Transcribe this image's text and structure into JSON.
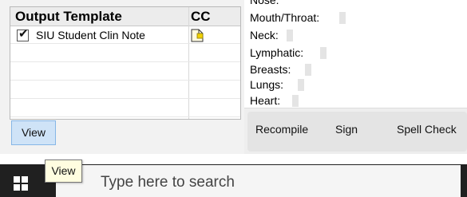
{
  "template_panel": {
    "col_output": "Output Template",
    "col_cc": "CC",
    "rows": [
      {
        "name": "SIU Student Clin Note",
        "checked": true,
        "cc_icon": "note-icon"
      }
    ],
    "view_label": "View"
  },
  "exam": {
    "partial_top": "Nose:",
    "fields": [
      "Mouth/Throat:",
      "Neck:",
      "Lymphatic:",
      "Breasts:",
      "Lungs:",
      "Heart:"
    ]
  },
  "toolbar": {
    "recompile": "Recompile",
    "sign": "Sign",
    "spell_check": "Spell Check"
  },
  "taskbar": {
    "tooltip": "View",
    "search_placeholder": "Type here to search",
    "start_icon": "windows-icon"
  }
}
